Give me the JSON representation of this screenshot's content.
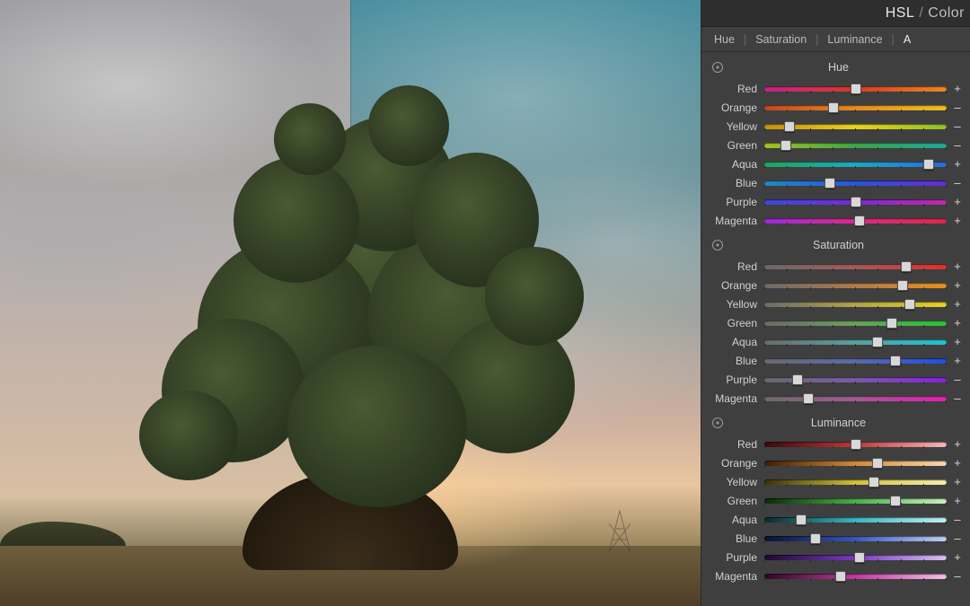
{
  "panel": {
    "title_main": "HSL",
    "title_sep": "/",
    "title_rest": "Color",
    "tabs": [
      {
        "label": "Hue",
        "active": false
      },
      {
        "label": "Saturation",
        "active": false
      },
      {
        "label": "Luminance",
        "active": false
      },
      {
        "label": "A",
        "active": true
      }
    ],
    "groups": [
      {
        "title": "Hue",
        "colors": [
          "Red",
          "Orange",
          "Yellow",
          "Green",
          "Aqua",
          "Blue",
          "Purple",
          "Magenta"
        ],
        "gradients": [
          [
            "#c02585",
            "#d73a2a",
            "#e88a1e"
          ],
          [
            "#c1481e",
            "#e88a1e",
            "#e8c21e"
          ],
          [
            "#c49014",
            "#e8d21e",
            "#8bbf2a"
          ],
          [
            "#a8c21e",
            "#3aa648",
            "#1ea89a"
          ],
          [
            "#1ea85a",
            "#1ea8c2",
            "#2a6ad9"
          ],
          [
            "#1e8ac2",
            "#2a55d9",
            "#6a2ad9"
          ],
          [
            "#3a4ad9",
            "#7a2ad9",
            "#c22aa8"
          ],
          [
            "#9a2ad9",
            "#d92a8a",
            "#d92a48"
          ]
        ],
        "values": [
          50,
          38,
          14,
          12,
          90,
          36,
          50,
          52
        ],
        "signs": [
          "+",
          "–",
          "–",
          "–",
          "+",
          "–",
          "+",
          "+"
        ]
      },
      {
        "title": "Saturation",
        "colors": [
          "Red",
          "Orange",
          "Yellow",
          "Green",
          "Aqua",
          "Blue",
          "Purple",
          "Magenta"
        ],
        "gradients": [
          [
            "#6a6a6a",
            "#a45a5a",
            "#e03030"
          ],
          [
            "#6a6a6a",
            "#b07a4a",
            "#e89020"
          ],
          [
            "#6a6a6a",
            "#b0a44a",
            "#e8d220"
          ],
          [
            "#6a6a6a",
            "#6aa05a",
            "#2ac23a"
          ],
          [
            "#6a6a6a",
            "#5aa0a0",
            "#20c2d2"
          ],
          [
            "#6a6a6a",
            "#5a6aa8",
            "#2050e0"
          ],
          [
            "#6a6a6a",
            "#7a5aa8",
            "#8a20e0"
          ],
          [
            "#6a6a6a",
            "#a05a90",
            "#e020b0"
          ]
        ],
        "values": [
          78,
          76,
          80,
          70,
          62,
          72,
          18,
          24
        ],
        "signs": [
          "+",
          "+",
          "+",
          "+",
          "+",
          "+",
          "–",
          "–"
        ]
      },
      {
        "title": "Luminance",
        "colors": [
          "Red",
          "Orange",
          "Yellow",
          "Green",
          "Aqua",
          "Blue",
          "Purple",
          "Magenta"
        ],
        "gradients": [
          [
            "#3a0a0a",
            "#c23838",
            "#f5b8b8"
          ],
          [
            "#3a1e0a",
            "#d28a38",
            "#f5d8b0"
          ],
          [
            "#3a320a",
            "#d2c238",
            "#f5eeb0"
          ],
          [
            "#0a2a0a",
            "#48b048",
            "#c8f0c0"
          ],
          [
            "#0a2a2e",
            "#38b8c2",
            "#c0eef2"
          ],
          [
            "#0a122e",
            "#3858c2",
            "#c0cef2"
          ],
          [
            "#1e0a2e",
            "#7a38c2",
            "#d8c0f2"
          ],
          [
            "#2e0a22",
            "#c238a0",
            "#f2c0e4"
          ]
        ],
        "values": [
          50,
          62,
          60,
          72,
          20,
          28,
          52,
          42
        ],
        "signs": [
          "+",
          "+",
          "+",
          "+",
          "–",
          "–",
          "+",
          "–"
        ]
      }
    ]
  }
}
